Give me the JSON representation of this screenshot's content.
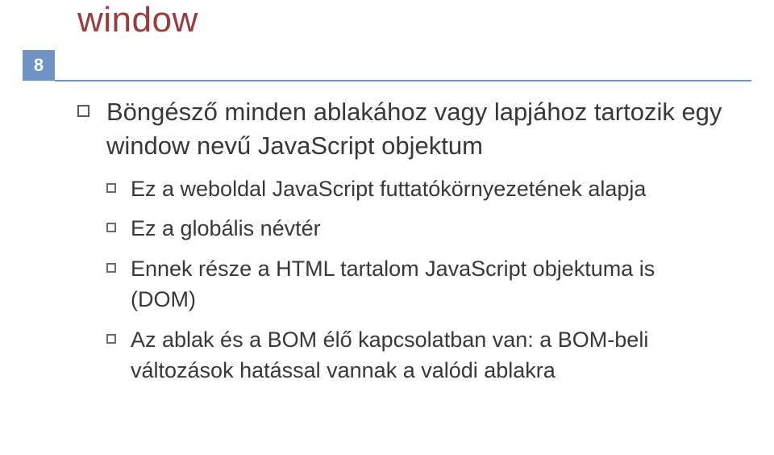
{
  "title": "window",
  "page_number": "8",
  "bullets": [
    {
      "text": "Böngésző minden ablakához vagy lapjához tartozik egy window nevű JavaScript objektum",
      "sub": [
        {
          "text": "Ez a weboldal JavaScript futtatókörnyezetének alapja"
        },
        {
          "text": "Ez a globális névtér"
        },
        {
          "text": "Ennek része a HTML tartalom JavaScript objektuma is (DOM)"
        },
        {
          "text": "Az ablak és a BOM élő kapcsolatban van: a BOM-beli változások hatással vannak a valódi ablakra"
        }
      ]
    }
  ]
}
